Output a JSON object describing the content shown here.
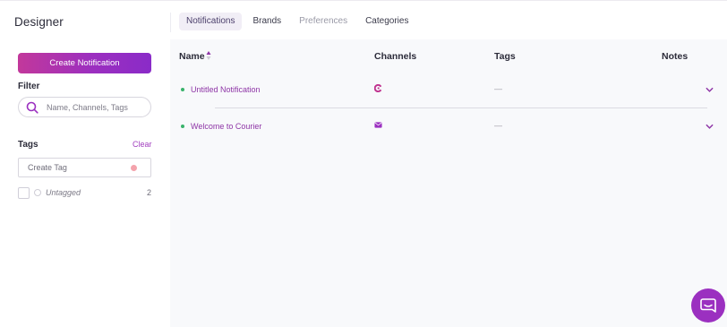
{
  "app": {
    "title": "Designer"
  },
  "tabs": [
    {
      "label": "Notifications",
      "state": "active"
    },
    {
      "label": "Brands",
      "state": "normal"
    },
    {
      "label": "Preferences",
      "state": "muted"
    },
    {
      "label": "Categories",
      "state": "normal"
    }
  ],
  "sidebar": {
    "create_button_label": "Create Notification",
    "filter_label": "Filter",
    "search_placeholder": "Name, Channels, Tags",
    "tags_label": "Tags",
    "clear_label": "Clear",
    "create_tag_placeholder": "Create Tag",
    "untagged": {
      "label": "Untagged",
      "count": "2"
    }
  },
  "table": {
    "columns": {
      "name": "Name",
      "channels": "Channels",
      "tags": "Tags",
      "notes": "Notes"
    },
    "sort": {
      "column": "Name",
      "direction": "ascending"
    },
    "rows": [
      {
        "name": "Untitled Notification",
        "channel_icon": "courier-logo-icon",
        "tags": "—",
        "status": "published"
      },
      {
        "name": "Welcome to Courier",
        "channel_icon": "email-icon",
        "tags": "—",
        "status": "published"
      }
    ]
  },
  "colors": {
    "accent": "#9c2fbf",
    "gradient_start": "#c2389b",
    "status_green": "#39b36b",
    "link_purple": "#8e35a6",
    "tag_dot": "#f4a3ac"
  },
  "chat_launcher": {
    "icon": "chat-bubble-icon"
  }
}
